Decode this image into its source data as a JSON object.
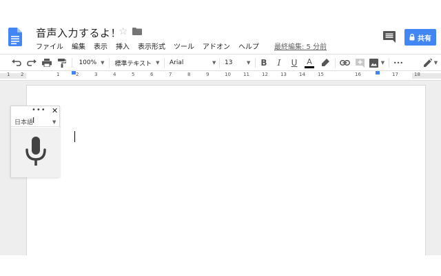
{
  "document": {
    "title": "音声入力するよ！",
    "last_edit": "最終編集: 5 分前"
  },
  "menu": {
    "items": [
      "ファイル",
      "編集",
      "表示",
      "挿入",
      "表示形式",
      "ツール",
      "アドオン",
      "ヘルプ"
    ]
  },
  "share": {
    "label": "共有"
  },
  "toolbar": {
    "zoom": "100%",
    "style": "標準テキスト",
    "font": "Arial",
    "size": "13",
    "bold": "B",
    "italic": "I",
    "underline": "U",
    "text_color": "A",
    "more": "•••"
  },
  "ruler": {
    "numbers": [
      "1",
      "2",
      "1",
      "2",
      "3",
      "4",
      "5",
      "6",
      "7",
      "8",
      "9",
      "10",
      "11",
      "12",
      "13",
      "14",
      "15",
      "16",
      "17",
      "18"
    ]
  },
  "voice_typing": {
    "dots": "•••",
    "close": "✕",
    "language": "日本語",
    "ibeam": "I"
  },
  "colors": {
    "accent": "#4285f4",
    "doc_icon": "#4285f4",
    "mic": "#424242"
  },
  "icons": [
    "doc-logo-icon",
    "star-icon",
    "folder-icon",
    "comment-icon",
    "lock-icon",
    "undo-icon",
    "redo-icon",
    "print-icon",
    "paint-format-icon",
    "highlighter-icon",
    "link-icon",
    "add-comment-icon",
    "image-icon",
    "pencil-icon",
    "microphone-icon",
    "close-icon",
    "more-icon"
  ]
}
